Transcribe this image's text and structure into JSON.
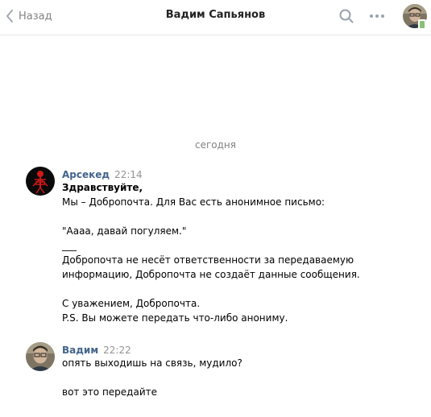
{
  "header": {
    "back_label": "Назад",
    "title": "Вадим Сапьянов",
    "icons": [
      "chevron-left-icon",
      "search-icon",
      "more-icon"
    ],
    "online_color": "#8ac176"
  },
  "chat": {
    "date_separator": "сегодня",
    "messages": [
      {
        "author": "Арсекед",
        "time": "22:14",
        "lines": [
          "Здравствуйте,",
          "Мы – Добропочта. Для Вас есть анонимное письмо:",
          "",
          "\"Аааа, давай погуляем.\"",
          "___",
          "Добропочта не несёт ответственности за передаваемую",
          "информацию, Добропочта не создаёт данные сообщения.",
          "",
          "С уважением, Добропочта.",
          "P.S. Вы можете передать что-либо анониму."
        ]
      },
      {
        "author": "Вадим",
        "time": "22:22",
        "lines": [
          "опять выходишь на связь, мудило?",
          "",
          "вот это передайте"
        ]
      }
    ]
  },
  "colors": {
    "author": "#42648b",
    "muted": "#828282",
    "divider": "#e7e8ec"
  }
}
